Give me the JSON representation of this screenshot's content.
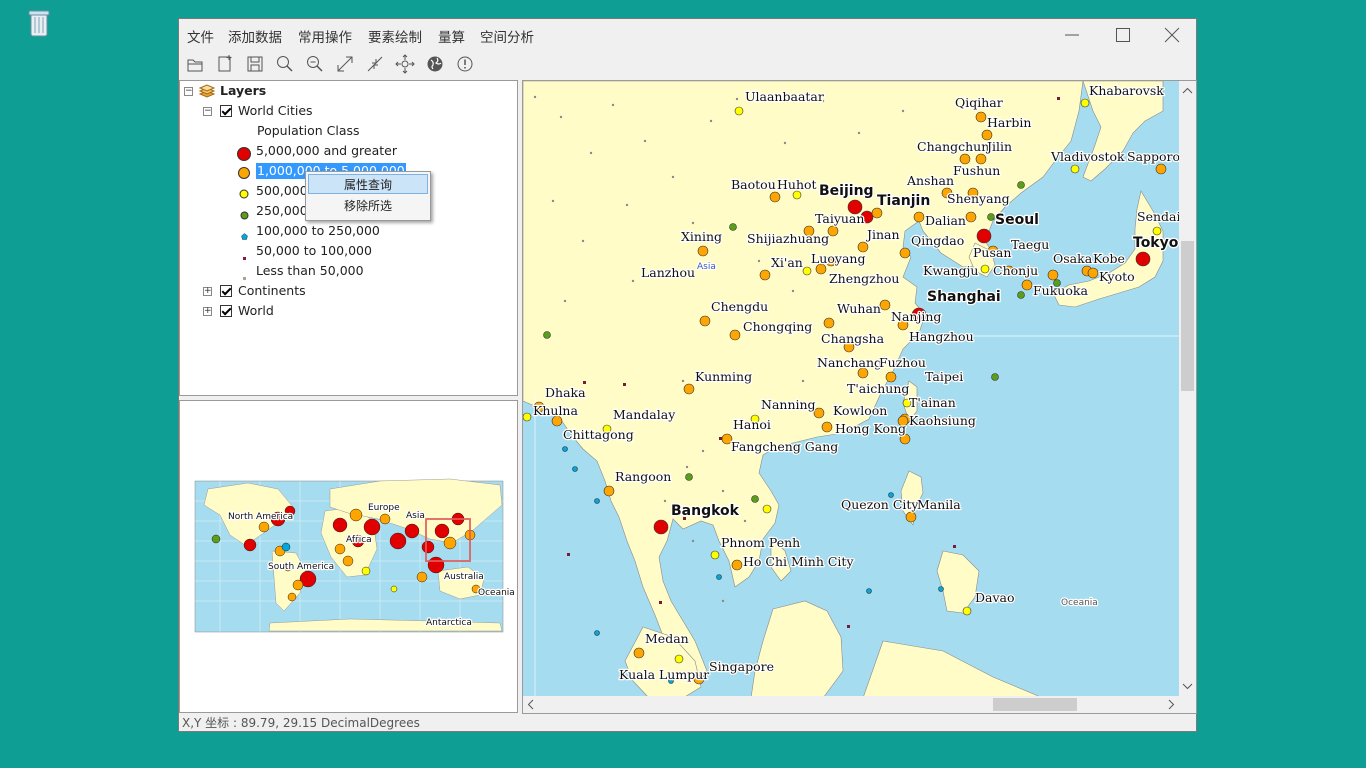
{
  "desktop": {
    "recycle_bin_icon": "recycle-bin-icon"
  },
  "menubar": {
    "items": [
      "文件",
      "添加数据",
      "常用操作",
      "要素绘制",
      "量算",
      "空间分析"
    ]
  },
  "toolbar": {
    "icons": [
      "open-icon",
      "new-icon",
      "save-icon",
      "zoom-in-icon",
      "zoom-out-icon",
      "full-extent-icon",
      "fixed-zoom-icon",
      "pan-icon",
      "globe-icon",
      "identify-icon"
    ]
  },
  "toc": {
    "root": "Layers",
    "layers": [
      {
        "name": "World Cities",
        "expanded": true,
        "checked": true
      },
      {
        "name": "Continents",
        "expanded": false,
        "checked": true
      },
      {
        "name": "World",
        "expanded": false,
        "checked": true
      }
    ],
    "field": "Population Class",
    "classes": [
      {
        "label": "5,000,000 and greater",
        "color": "#e00000"
      },
      {
        "label": "1,000,000 to 5,000,000",
        "color": "#ffa500"
      },
      {
        "label": "500,000",
        "color": "#ffff00"
      },
      {
        "label": "250,000",
        "color": "#5a9e1a"
      },
      {
        "label": "100,000 to 250,000",
        "color": "#00a8e0"
      },
      {
        "label": "50,000 to 100,000",
        "color": "#8b1a3a"
      },
      {
        "label": "Less than 50,000",
        "color": "#b0a090"
      }
    ]
  },
  "context_menu": {
    "items": [
      "属性查询",
      "移除所选"
    ]
  },
  "overview": {
    "labels": [
      "North America",
      "Europe",
      "Asia",
      "Africa",
      "South America",
      "Australia",
      "Oceania",
      "Antarctica"
    ]
  },
  "map": {
    "region_labels": [
      "Asia",
      "Oceania"
    ],
    "major_cities": [
      "Beijing",
      "Tianjin",
      "Seoul",
      "Tokyo",
      "Shanghai",
      "Bangkok"
    ],
    "cities": [
      "Ulaanbaatar",
      "Qiqihar",
      "Harbin",
      "Khabarovsk",
      "Changchun",
      "Jilin",
      "Vladivostok",
      "Sapporo",
      "Fushun",
      "Baotou",
      "Huhot",
      "Anshan",
      "Shenyang",
      "Taiyuan",
      "Dalian",
      "Sendai",
      "Xining",
      "Shijiazhuang",
      "Jinan",
      "Qingdao",
      "Taegu",
      "Asia",
      "Lanzhou",
      "Xi'an",
      "Luoyang",
      "Zhengzhou",
      "Kwangju",
      "Chonju",
      "Pusan",
      "Osaka",
      "Kobe",
      "Kyoto",
      "Fukuoka",
      "Chengdu",
      "Wuhan",
      "Nanjing",
      "Chongqing",
      "Hangzhou",
      "Changsha",
      "Nanchang",
      "Fuzhou",
      "Kunming",
      "T'aichung",
      "Taipei",
      "T'ainan",
      "Kaohsiung",
      "Dhaka",
      "Khulna",
      "Mandalay",
      "Chittagong",
      "Nanning",
      "Kowloon",
      "Hong Kong",
      "Hanoi",
      "Fangcheng Gang",
      "Rangoon",
      "Quezon City",
      "Manila",
      "Phnom Penh",
      "Ho Chi Minh City",
      "Davao",
      "Medan",
      "Kuala Lumpur",
      "Singapore"
    ]
  },
  "status": {
    "text": "X,Y 坐标 : 89.79, 29.15  DecimalDegrees"
  },
  "colors": {
    "desktop": "#0f9e94",
    "land": "#fffcc8",
    "water": "#a6dcf0",
    "selection": "#3399ff"
  }
}
